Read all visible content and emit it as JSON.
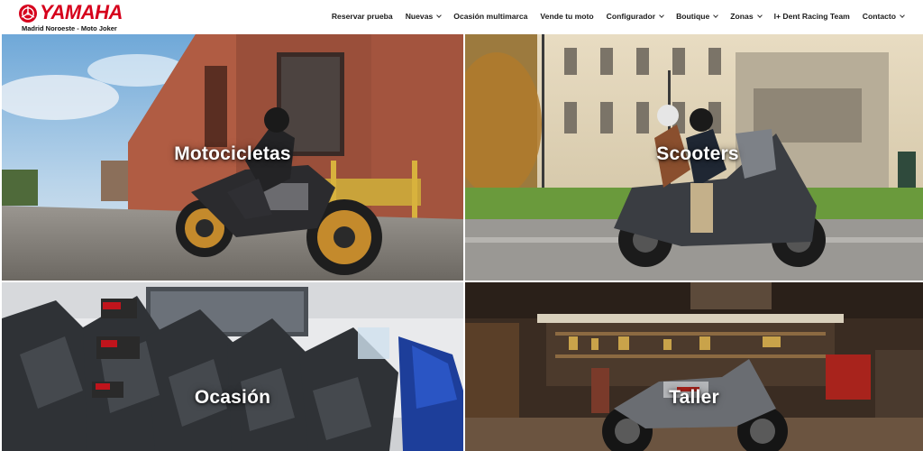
{
  "brand": {
    "name": "YAMAHA",
    "subtitle": "Madrid Noroeste - Moto Joker",
    "color": "#d6001c"
  },
  "nav": {
    "items": [
      {
        "label": "Reservar prueba",
        "dropdown": false
      },
      {
        "label": "Nuevas",
        "dropdown": true
      },
      {
        "label": "Ocasión multimarca",
        "dropdown": false
      },
      {
        "label": "Vende tu moto",
        "dropdown": false
      },
      {
        "label": "Configurador",
        "dropdown": true
      },
      {
        "label": "Boutique",
        "dropdown": true
      },
      {
        "label": "Zonas",
        "dropdown": true
      },
      {
        "label": "I+ Dent Racing Team",
        "dropdown": false
      },
      {
        "label": "Contacto",
        "dropdown": true
      }
    ]
  },
  "tiles": [
    {
      "label": "Motocicletas"
    },
    {
      "label": "Scooters"
    },
    {
      "label": "Ocasión"
    },
    {
      "label": "Taller"
    }
  ]
}
